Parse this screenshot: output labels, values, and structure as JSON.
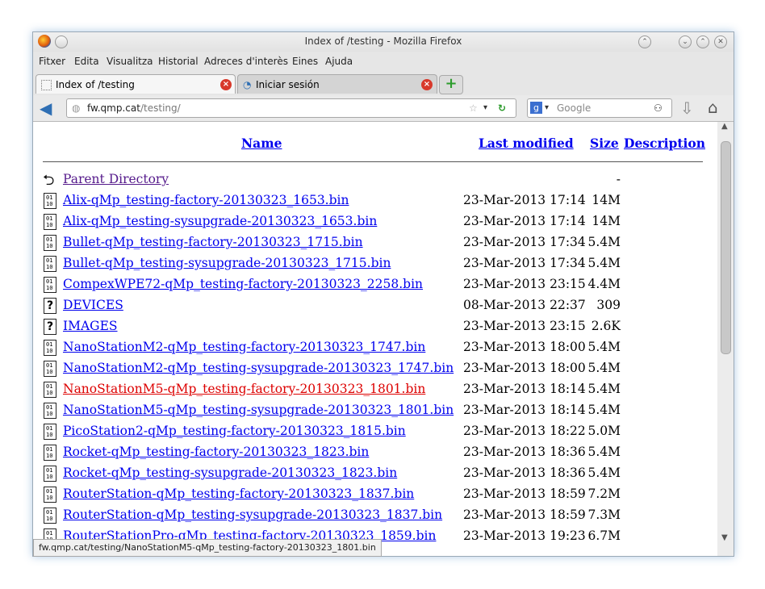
{
  "window": {
    "title": "Index of /testing - Mozilla Firefox"
  },
  "menu": [
    "Fitxer",
    "Edita",
    "Visualitza",
    "Historial",
    "Adreces d'interès",
    "Eines",
    "Ajuda"
  ],
  "tabs": [
    {
      "label": "Index of /testing",
      "active": true
    },
    {
      "label": "Iniciar sesión",
      "active": false
    }
  ],
  "nav": {
    "url_host": "fw.qmp.cat",
    "url_path": "/testing/",
    "search_placeholder": "Google"
  },
  "table": {
    "headers": {
      "name": "Name",
      "last_modified": "Last modified",
      "size": "Size",
      "description": "Description"
    },
    "parent": {
      "name": "Parent Directory",
      "size": "-"
    },
    "rows": [
      {
        "name": "Alix-qMp_testing-factory-20130323_1653.bin",
        "date": "23-Mar-2013 17:14",
        "size": "14M",
        "icon": "binary-file-icon"
      },
      {
        "name": "Alix-qMp_testing-sysupgrade-20130323_1653.bin",
        "date": "23-Mar-2013 17:14",
        "size": "14M",
        "icon": "binary-file-icon"
      },
      {
        "name": "Bullet-qMp_testing-factory-20130323_1715.bin",
        "date": "23-Mar-2013 17:34",
        "size": "5.4M",
        "icon": "binary-file-icon"
      },
      {
        "name": "Bullet-qMp_testing-sysupgrade-20130323_1715.bin",
        "date": "23-Mar-2013 17:34",
        "size": "5.4M",
        "icon": "binary-file-icon"
      },
      {
        "name": "CompexWPE72-qMp_testing-factory-20130323_2258.bin",
        "date": "23-Mar-2013 23:15",
        "size": "4.4M",
        "icon": "binary-file-icon"
      },
      {
        "name": "DEVICES",
        "date": "08-Mar-2013 22:37",
        "size": "309",
        "icon": "unknown-file-icon"
      },
      {
        "name": "IMAGES",
        "date": "23-Mar-2013 23:15",
        "size": "2.6K",
        "icon": "unknown-file-icon"
      },
      {
        "name": "NanoStationM2-qMp_testing-factory-20130323_1747.bin",
        "date": "23-Mar-2013 18:00",
        "size": "5.4M",
        "icon": "binary-file-icon"
      },
      {
        "name": "NanoStationM2-qMp_testing-sysupgrade-20130323_1747.bin",
        "date": "23-Mar-2013 18:00",
        "size": "5.4M",
        "icon": "binary-file-icon"
      },
      {
        "name": "NanoStationM5-qMp_testing-factory-20130323_1801.bin",
        "date": "23-Mar-2013 18:14",
        "size": "5.4M",
        "icon": "binary-file-icon",
        "hover": true
      },
      {
        "name": "NanoStationM5-qMp_testing-sysupgrade-20130323_1801.bin",
        "date": "23-Mar-2013 18:14",
        "size": "5.4M",
        "icon": "binary-file-icon"
      },
      {
        "name": "PicoStation2-qMp_testing-factory-20130323_1815.bin",
        "date": "23-Mar-2013 18:22",
        "size": "5.0M",
        "icon": "binary-file-icon"
      },
      {
        "name": "Rocket-qMp_testing-factory-20130323_1823.bin",
        "date": "23-Mar-2013 18:36",
        "size": "5.4M",
        "icon": "binary-file-icon"
      },
      {
        "name": "Rocket-qMp_testing-sysupgrade-20130323_1823.bin",
        "date": "23-Mar-2013 18:36",
        "size": "5.4M",
        "icon": "binary-file-icon"
      },
      {
        "name": "RouterStation-qMp_testing-factory-20130323_1837.bin",
        "date": "23-Mar-2013 18:59",
        "size": "7.2M",
        "icon": "binary-file-icon"
      },
      {
        "name": "RouterStation-qMp_testing-sysupgrade-20130323_1837.bin",
        "date": "23-Mar-2013 18:59",
        "size": "7.3M",
        "icon": "binary-file-icon"
      },
      {
        "name": "RouterStationPro-qMp_testing-factory-20130323_1859.bin",
        "date": "23-Mar-2013 19:23",
        "size": "6.7M",
        "icon": "binary-file-icon"
      }
    ]
  },
  "status": {
    "text": "fw.qmp.cat/testing/NanoStationM5-qMp_testing-factory-20130323_1801.bin"
  },
  "colors": {
    "link": "#0000ee",
    "hover_link": "#dd0000",
    "visited": "#551a8b"
  }
}
